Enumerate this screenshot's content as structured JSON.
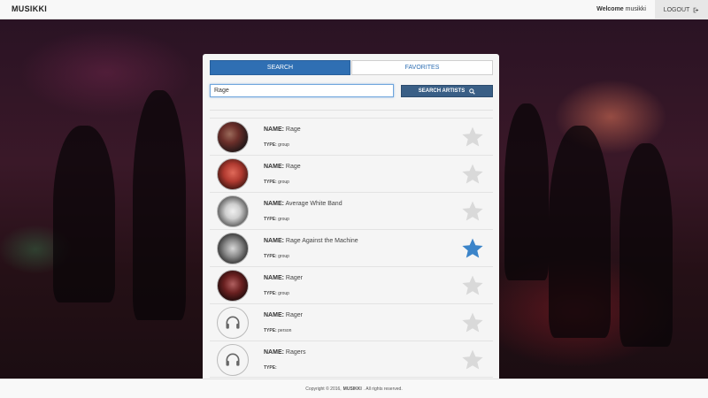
{
  "navbar": {
    "brand": "MUSIKKI",
    "welcome_label": "Welcome",
    "username": "musikki",
    "logout_label": "LOGOUT"
  },
  "tabs": {
    "search": "SEARCH",
    "favorites": "FAVORITES"
  },
  "search": {
    "value": "Rage",
    "button_label": "SEARCH ARTISTS"
  },
  "labels": {
    "name": "NAME:",
    "type": "TYPE:"
  },
  "results": [
    {
      "name": "Rage",
      "type": "group",
      "favorite": false,
      "avatar": "photo"
    },
    {
      "name": "Rage",
      "type": "group",
      "favorite": false,
      "avatar": "photo"
    },
    {
      "name": "Average White Band",
      "type": "group",
      "favorite": false,
      "avatar": "photo"
    },
    {
      "name": "Rage Against the Machine",
      "type": "group",
      "favorite": true,
      "avatar": "photo"
    },
    {
      "name": "Rager",
      "type": "group",
      "favorite": false,
      "avatar": "photo"
    },
    {
      "name": "Rager",
      "type": "person",
      "favorite": false,
      "avatar": "headphones-icon"
    },
    {
      "name": "Ragers",
      "type": "",
      "favorite": false,
      "avatar": "headphones-icon"
    }
  ],
  "footer": {
    "prefix": "Copyright © 2016,",
    "brand": "MUSIKKI",
    "suffix": ". All rights reserved."
  },
  "colors": {
    "accent": "#2f6fb3",
    "button": "#3a5f86",
    "star_active": "#3b84c9",
    "star_inactive": "#d9d9d9"
  }
}
